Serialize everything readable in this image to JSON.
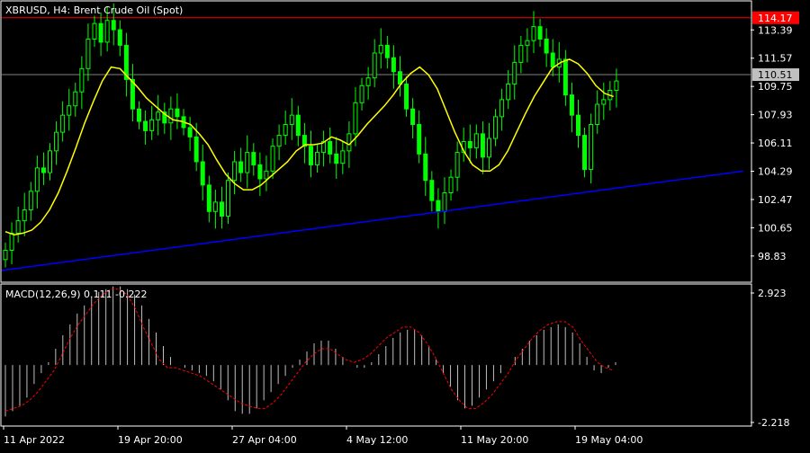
{
  "chart_data": [
    {
      "type": "candlestick",
      "symbol_label": "XBRUSD, H4:  Brent Crude Oil (Spot)",
      "y_ticks": [
        "113.39",
        "111.57",
        "109.75",
        "107.93",
        "106.11",
        "104.29",
        "102.47",
        "100.65",
        "98.83"
      ],
      "ylim": [
        97.2,
        115.2
      ],
      "x_labels": [
        "11 Apr 2022",
        "19 Apr 20:00",
        "27 Apr 04:00",
        "4 May 12:00",
        "11 May 20:00",
        "19 May 04:00"
      ],
      "price_tags": [
        {
          "label": "114.17",
          "value": 114.17,
          "color": "#ff0000",
          "text_color": "#ffffff"
        },
        {
          "label": "110.51",
          "value": 110.51,
          "color": "#c0c0c0",
          "text_color": "#000000"
        }
      ],
      "close_series": [
        99.2,
        100.3,
        101.1,
        101.8,
        103.0,
        104.5,
        104.2,
        105.6,
        106.8,
        107.9,
        108.5,
        109.4,
        110.9,
        112.8,
        113.8,
        112.6,
        114.0,
        113.4,
        112.4,
        110.2,
        108.3,
        107.5,
        106.9,
        107.6,
        108.1,
        107.4,
        108.3,
        107.8,
        107.1,
        106.5,
        104.9,
        103.4,
        101.7,
        102.3,
        101.4,
        103.7,
        104.9,
        104.2,
        105.5,
        104.7,
        103.8,
        104.3,
        105.9,
        106.6,
        107.3,
        107.9,
        106.6,
        105.9,
        104.7,
        105.5,
        106.2,
        105.4,
        104.8,
        105.6,
        106.7,
        108.7,
        109.8,
        110.3,
        111.9,
        112.4,
        111.6,
        110.7,
        109.9,
        108.3,
        107.3,
        105.4,
        103.7,
        102.4,
        101.7,
        102.9,
        103.9,
        105.5,
        106.2,
        105.8,
        106.7,
        105.2,
        106.4,
        107.8,
        108.9,
        109.9,
        111.3,
        112.4,
        112.7,
        113.6,
        112.8,
        111.9,
        111.0,
        111.5,
        109.2,
        107.9,
        106.6,
        104.4,
        107.3,
        108.6,
        108.9,
        109.5,
        110.1
      ],
      "ma_series": [
        100.4,
        100.2,
        100.3,
        100.5,
        101.0,
        101.8,
        102.9,
        104.3,
        105.8,
        107.4,
        108.8,
        110.1,
        111.0,
        110.9,
        110.3,
        109.7,
        109.0,
        108.5,
        108.0,
        107.6,
        107.5,
        107.3,
        106.7,
        106.0,
        105.0,
        104.1,
        103.5,
        103.1,
        103.1,
        103.4,
        103.9,
        104.4,
        104.9,
        105.6,
        106.0,
        106.0,
        106.1,
        106.5,
        106.3,
        106.0,
        106.6,
        107.3,
        107.9,
        108.5,
        109.2,
        110.0,
        110.6,
        111.0,
        110.5,
        109.6,
        108.2,
        106.8,
        105.6,
        104.7,
        104.3,
        104.3,
        104.7,
        105.6,
        106.8,
        108.0,
        109.1,
        110.0,
        110.9,
        111.3,
        111.5,
        111.2,
        110.6,
        109.8,
        109.3,
        109.1
      ],
      "trend_line": {
        "from": [
          0,
          97.9
        ],
        "to": [
          1,
          104.3
        ],
        "color": "#0000ff"
      },
      "resistance_line": {
        "value": 114.17,
        "color": "#ff0000"
      },
      "colors": {
        "candles": "#00ff00",
        "ma": "#ffff00",
        "grid": "#ffffff",
        "background": "#000000"
      }
    },
    {
      "type": "histogram+line",
      "label": "MACD(12,26,9) 0.111 -0.222",
      "y_ticks": [
        "2.923",
        "-2.218"
      ],
      "ylim": [
        -2.218,
        2.923
      ],
      "histogram": [
        -1.9,
        -1.7,
        -1.5,
        -1.2,
        -0.7,
        -0.3,
        0.1,
        0.6,
        1.1,
        1.5,
        1.9,
        2.2,
        2.5,
        2.7,
        2.8,
        2.9,
        2.9,
        2.8,
        2.6,
        2.2,
        1.7,
        1.2,
        0.7,
        0.3,
        0.0,
        -0.1,
        -0.2,
        -0.3,
        -0.4,
        -0.6,
        -0.9,
        -1.3,
        -1.7,
        -1.8,
        -1.8,
        -1.6,
        -1.3,
        -1.0,
        -0.7,
        -0.4,
        -0.1,
        0.2,
        0.5,
        0.8,
        0.9,
        0.9,
        0.6,
        0.3,
        0.0,
        -0.1,
        -0.1,
        0.1,
        0.4,
        0.7,
        1.0,
        1.2,
        1.3,
        1.3,
        1.1,
        0.7,
        0.2,
        -0.3,
        -0.8,
        -1.3,
        -1.6,
        -1.5,
        -1.2,
        -0.9,
        -0.6,
        -0.3,
        0.0,
        0.3,
        0.6,
        0.9,
        1.1,
        1.3,
        1.4,
        1.5,
        1.4,
        1.2,
        0.8,
        0.3,
        -0.2,
        -0.3,
        -0.1,
        0.1
      ],
      "signal": [
        -1.7,
        -1.6,
        -1.5,
        -1.3,
        -1.0,
        -0.6,
        -0.2,
        0.4,
        1.0,
        1.5,
        1.9,
        2.3,
        2.6,
        2.8,
        2.8,
        2.6,
        2.1,
        1.4,
        0.8,
        0.2,
        -0.1,
        -0.1,
        -0.2,
        -0.3,
        -0.4,
        -0.6,
        -0.8,
        -1.0,
        -1.2,
        -1.4,
        -1.5,
        -1.6,
        -1.6,
        -1.4,
        -1.1,
        -0.7,
        -0.3,
        0.1,
        0.4,
        0.6,
        0.6,
        0.4,
        0.2,
        0.1,
        0.2,
        0.4,
        0.7,
        1.0,
        1.2,
        1.4,
        1.4,
        1.2,
        0.8,
        0.3,
        -0.3,
        -0.9,
        -1.3,
        -1.6,
        -1.6,
        -1.4,
        -1.1,
        -0.7,
        -0.3,
        0.2,
        0.6,
        1.0,
        1.3,
        1.5,
        1.6,
        1.6,
        1.4,
        0.9,
        0.5,
        0.1,
        -0.1,
        -0.2
      ],
      "colors": {
        "histogram": "#c0c0c0",
        "signal": "#ff0000"
      }
    }
  ]
}
